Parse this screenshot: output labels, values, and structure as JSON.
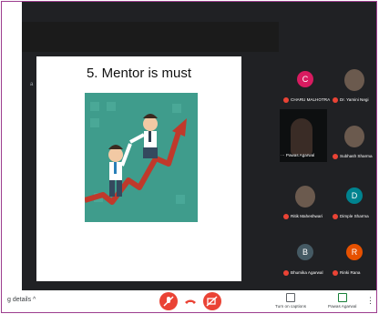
{
  "slide": {
    "title": "5. Mentor is must"
  },
  "participants": [
    {
      "name": "CHARU MALHOTRA",
      "initial": "C",
      "color": "#d81b60",
      "muted": true
    },
    {
      "name": "Dr. Yamini Negi",
      "initial": "",
      "color": "#6b5a4e",
      "muted": true
    },
    {
      "name": "Pawas Agarwal",
      "initial": "",
      "color": "#000000",
      "muted": false,
      "prefix": "⋯"
    },
    {
      "name": "Subhash Sharma",
      "initial": "",
      "color": "#6b5a4e",
      "muted": true
    },
    {
      "name": "Ritik Maheshwari",
      "initial": "",
      "color": "#6b5a4e",
      "muted": true
    },
    {
      "name": "Dimple Sharma",
      "initial": "D",
      "color": "#00838f",
      "muted": true
    },
    {
      "name": "Bhumika Agarwal",
      "initial": "B",
      "color": "#455a64",
      "muted": true
    },
    {
      "name": "Rinki Rana",
      "initial": "R",
      "color": "#e65100",
      "muted": true
    }
  ],
  "bottom_bar": {
    "meeting_details": "g details  ^",
    "turn_on_captions": "Turn on captions",
    "presenting": "Pawas Agarwal",
    "more": "⋮"
  },
  "icons": {
    "mic": "mic-off-icon",
    "hangup": "hang-up-icon",
    "camera": "camera-off-icon"
  }
}
